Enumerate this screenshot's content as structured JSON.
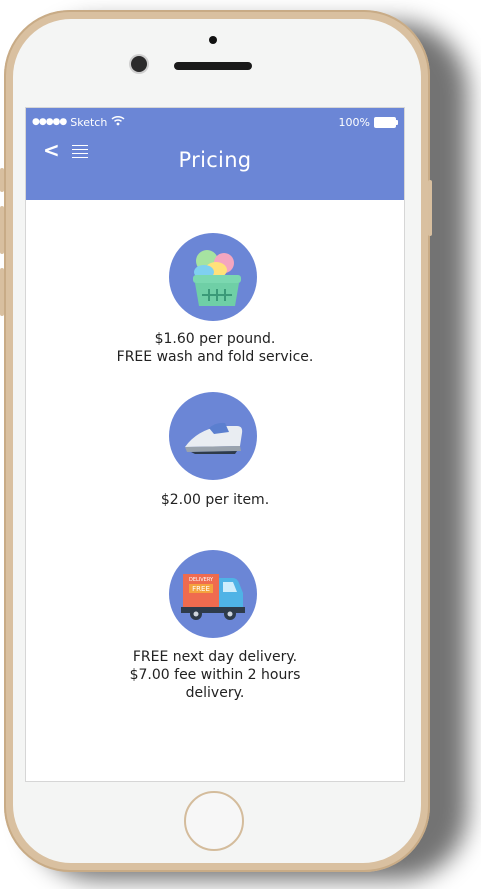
{
  "status_bar": {
    "signal_dots": "●●●●●",
    "carrier": "Sketch",
    "battery_percent": "100%"
  },
  "header": {
    "back_glyph": "<",
    "title": "Pricing"
  },
  "items": [
    {
      "icon": "laundry-basket-icon",
      "lines": [
        "$1.60 per pound.",
        "FREE wash and fold service."
      ]
    },
    {
      "icon": "iron-icon",
      "lines": [
        "$2.00 per item."
      ]
    },
    {
      "icon": "delivery-truck-icon",
      "truck_text_small": "DELIVERY",
      "truck_text_big": "FREE",
      "lines": [
        "FREE next day delivery.",
        "$7.00 fee within 2 hours",
        "delivery."
      ]
    }
  ],
  "colors": {
    "accent": "#6b86d6",
    "phone_frame": "#d9c0a0",
    "truck_cargo": "#ef6b4f",
    "truck_cab": "#4fb3e6",
    "basket": "#6fcfa6"
  }
}
